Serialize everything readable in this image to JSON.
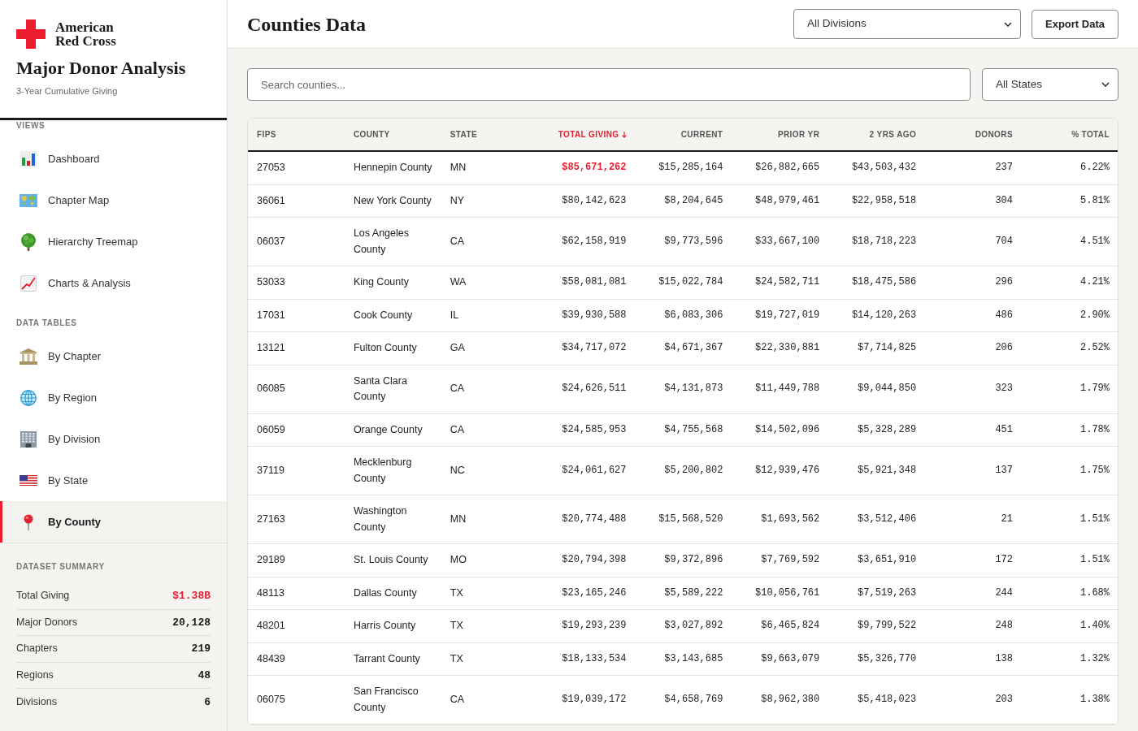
{
  "sidebar": {
    "logo_text": [
      "American",
      "Red Cross"
    ],
    "title": "Major Donor Analysis",
    "subtitle": "3-Year Cumulative Giving",
    "sections": [
      {
        "title": "VIEWS",
        "items": [
          {
            "label": "Dashboard",
            "selected": false
          },
          {
            "label": "Chapter Map",
            "selected": false
          },
          {
            "label": "Hierarchy Treemap",
            "selected": false
          },
          {
            "label": "Charts & Analysis",
            "selected": false
          }
        ]
      },
      {
        "title": "DATA TABLES",
        "items": [
          {
            "label": "By Chapter",
            "selected": false
          },
          {
            "label": "By Region",
            "selected": false
          },
          {
            "label": "By Division",
            "selected": false
          },
          {
            "label": "By State",
            "selected": false
          },
          {
            "label": "By County",
            "selected": true
          }
        ]
      }
    ],
    "summary": {
      "title": "DATASET SUMMARY",
      "stats": [
        {
          "label": "Total Giving",
          "value": "$1.38B",
          "highlighted": true
        },
        {
          "label": "Major Donors",
          "value": "20,128",
          "highlighted": false
        },
        {
          "label": "Chapters",
          "value": "219",
          "highlighted": false
        },
        {
          "label": "Regions",
          "value": "48",
          "highlighted": false
        },
        {
          "label": "Divisions",
          "value": "6",
          "highlighted": false
        }
      ]
    }
  },
  "header": {
    "title": "Counties Data",
    "division_filter": {
      "value": "All Divisions"
    },
    "buttons": [
      "Export Data"
    ]
  },
  "filters": {
    "search": {
      "placeholder": "Search counties..."
    },
    "state_filter": {
      "value": "All States"
    }
  },
  "table": {
    "columns": [
      {
        "label": "FIPS",
        "kind": "text",
        "sorted": false
      },
      {
        "label": "COUNTY",
        "kind": "text",
        "sorted": false
      },
      {
        "label": "STATE",
        "kind": "text",
        "sorted": false
      },
      {
        "label": "TOTAL GIVING",
        "kind": "number",
        "sorted": true
      },
      {
        "label": "CURRENT",
        "kind": "number",
        "sorted": false
      },
      {
        "label": "PRIOR YR",
        "kind": "number",
        "sorted": false
      },
      {
        "label": "2 YRS AGO",
        "kind": "number",
        "sorted": false
      },
      {
        "label": "DONORS",
        "kind": "number",
        "sorted": false
      },
      {
        "label": "% TOTAL",
        "kind": "number",
        "sorted": false
      }
    ],
    "rows": [
      {
        "highlighted": true,
        "cells": [
          "27053",
          "Hennepin County",
          "MN",
          "$85,671,262",
          "$15,285,164",
          "$26,882,665",
          "$43,503,432",
          "237",
          "6.22%"
        ]
      },
      {
        "highlighted": false,
        "cells": [
          "36061",
          "New York County",
          "NY",
          "$80,142,623",
          "$8,204,645",
          "$48,979,461",
          "$22,958,518",
          "304",
          "5.81%"
        ]
      },
      {
        "highlighted": false,
        "cells": [
          "06037",
          "Los Angeles County",
          "CA",
          "$62,158,919",
          "$9,773,596",
          "$33,667,100",
          "$18,718,223",
          "704",
          "4.51%"
        ]
      },
      {
        "highlighted": false,
        "cells": [
          "53033",
          "King County",
          "WA",
          "$58,081,081",
          "$15,022,784",
          "$24,582,711",
          "$18,475,586",
          "296",
          "4.21%"
        ]
      },
      {
        "highlighted": false,
        "cells": [
          "17031",
          "Cook County",
          "IL",
          "$39,930,588",
          "$6,083,306",
          "$19,727,019",
          "$14,120,263",
          "486",
          "2.90%"
        ]
      },
      {
        "highlighted": false,
        "cells": [
          "13121",
          "Fulton County",
          "GA",
          "$34,717,072",
          "$4,671,367",
          "$22,330,881",
          "$7,714,825",
          "206",
          "2.52%"
        ]
      },
      {
        "highlighted": false,
        "cells": [
          "06085",
          "Santa Clara County",
          "CA",
          "$24,626,511",
          "$4,131,873",
          "$11,449,788",
          "$9,044,850",
          "323",
          "1.79%"
        ]
      },
      {
        "highlighted": false,
        "cells": [
          "06059",
          "Orange County",
          "CA",
          "$24,585,953",
          "$4,755,568",
          "$14,502,096",
          "$5,328,289",
          "451",
          "1.78%"
        ]
      },
      {
        "highlighted": false,
        "cells": [
          "37119",
          "Mecklenburg County",
          "NC",
          "$24,061,627",
          "$5,200,802",
          "$12,939,476",
          "$5,921,348",
          "137",
          "1.75%"
        ]
      },
      {
        "highlighted": false,
        "cells": [
          "27163",
          "Washington County",
          "MN",
          "$20,774,488",
          "$15,568,520",
          "$1,693,562",
          "$3,512,406",
          "21",
          "1.51%"
        ]
      },
      {
        "highlighted": false,
        "cells": [
          "29189",
          "St. Louis County",
          "MO",
          "$20,794,398",
          "$9,372,896",
          "$7,769,592",
          "$3,651,910",
          "172",
          "1.51%"
        ]
      },
      {
        "highlighted": false,
        "cells": [
          "48113",
          "Dallas County",
          "TX",
          "$23,165,246",
          "$5,589,222",
          "$10,056,761",
          "$7,519,263",
          "244",
          "1.68%"
        ]
      },
      {
        "highlighted": false,
        "cells": [
          "48201",
          "Harris County",
          "TX",
          "$19,293,239",
          "$3,027,892",
          "$6,465,824",
          "$9,799,522",
          "248",
          "1.40%"
        ]
      },
      {
        "highlighted": false,
        "cells": [
          "48439",
          "Tarrant County",
          "TX",
          "$18,133,534",
          "$3,143,685",
          "$9,663,079",
          "$5,326,770",
          "138",
          "1.32%"
        ]
      },
      {
        "highlighted": false,
        "cells": [
          "06075",
          "San Francisco County",
          "CA",
          "$19,039,172",
          "$4,658,769",
          "$8,962,380",
          "$5,418,023",
          "203",
          "1.38%"
        ]
      }
    ]
  }
}
